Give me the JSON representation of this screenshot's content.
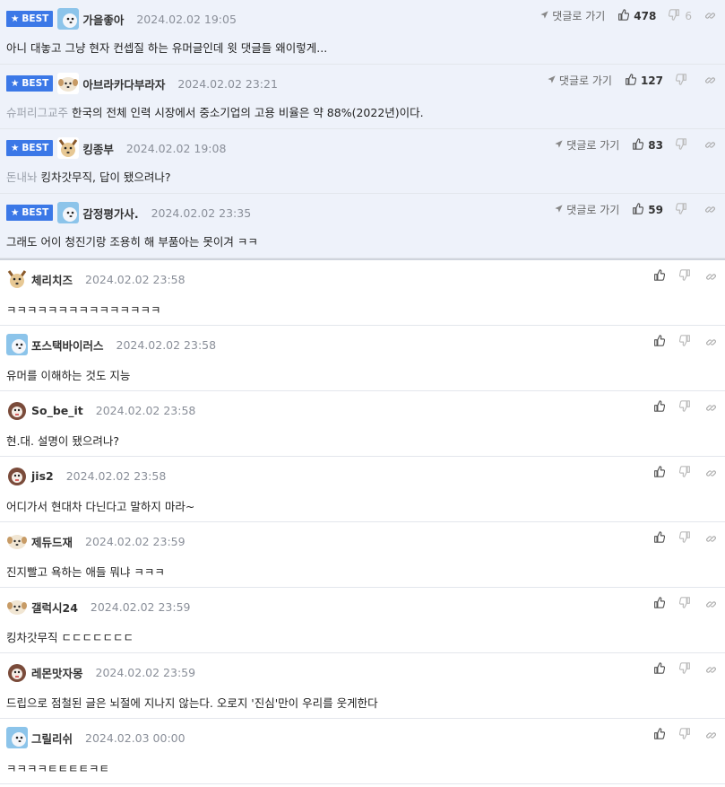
{
  "best_badge_label": "BEST",
  "goto_label": "댓글로 가기",
  "best_comments": [
    {
      "nickname": "가을좋아",
      "date": "2024.02.02 19:05",
      "prefix": "",
      "text": "아니 대놓고 그냥 현자 컨셉질 하는 유머글인데 윗 댓글들 왜이렇게...",
      "likes": "478",
      "dislikes": "6",
      "avatar": "blue"
    },
    {
      "nickname": "아브라카다부라자",
      "date": "2024.02.02 23:21",
      "prefix": "슈퍼리그교주",
      "text": "한국의 전체 인력 시장에서 중소기업의 고용 비율은 약 88%(2022년)이다.",
      "likes": "127",
      "dislikes": "",
      "avatar": "white"
    },
    {
      "nickname": "킹종부",
      "date": "2024.02.02 19:08",
      "prefix": "돈내놔",
      "text": "킹차갓무직, 답이 됐으려나?",
      "likes": "83",
      "dislikes": "",
      "avatar": "tan"
    },
    {
      "nickname": "감정평가사.",
      "date": "2024.02.02 23:35",
      "prefix": "",
      "text": "그래도 어이 청진기랑 조용히 해 부품아는 못이겨 ㅋㅋ",
      "likes": "59",
      "dislikes": "",
      "avatar": "blue"
    }
  ],
  "comments": [
    {
      "nickname": "체리치즈",
      "date": "2024.02.02 23:58",
      "text": "ㅋㅋㅋㅋㅋㅋㅋㅋㅋㅋㅋㅋㅋㅋㅋ",
      "avatar": "tan"
    },
    {
      "nickname": "포스택바이러스",
      "date": "2024.02.02 23:58",
      "text": "유머를 이해하는 것도 지능",
      "avatar": "blue"
    },
    {
      "nickname": "So_be_it",
      "date": "2024.02.02 23:58",
      "text": "현.대. 설명이 됐으려나?",
      "avatar": "dark"
    },
    {
      "nickname": "jis2",
      "date": "2024.02.02 23:58",
      "text": "어디가서 현대차 다닌다고 말하지 마라~",
      "avatar": "dark"
    },
    {
      "nickname": "제듀드재",
      "date": "2024.02.02 23:59",
      "text": "진지빨고 욕하는 애들 뭐냐 ㅋㅋㅋ",
      "avatar": "white"
    },
    {
      "nickname": "갤럭시24",
      "date": "2024.02.02 23:59",
      "text": "킹차갓무직 ㄷㄷㄷㄷㄷㄷㄷ",
      "avatar": "white"
    },
    {
      "nickname": "레몬맛자몽",
      "date": "2024.02.02 23:59",
      "text": "드립으로 점철된 글은 뇌절에 지나지 않는다. 오로지 '진심'만이 우리를 웃게한다",
      "avatar": "dark"
    },
    {
      "nickname": "그릴리쉬",
      "date": "2024.02.03 00:00",
      "text": "ㅋㅋㅋㅋㅌㅌㅌㅌㅋㅌ",
      "avatar": "blue"
    }
  ]
}
